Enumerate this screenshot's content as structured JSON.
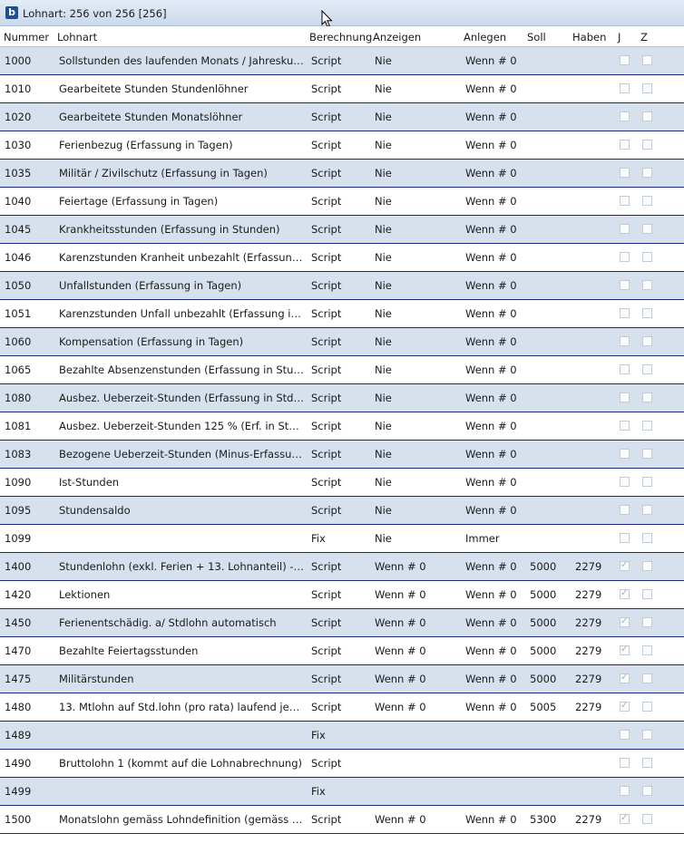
{
  "window": {
    "icon_letter": "b",
    "title": "Lohnart: 256 von 256 [256]"
  },
  "columns": [
    "Nummer",
    "Lohnart",
    "Berechnung",
    "Anzeigen",
    "Anlegen",
    "Soll",
    "Haben",
    "J",
    "Z"
  ],
  "rows": [
    {
      "nummer": "1000",
      "lohnart": "Sollstunden des laufenden Monats / Jahreskum...",
      "berechnung": "Script",
      "anzeigen": "Nie",
      "anlegen": "Wenn # 0",
      "soll": "",
      "haben": "",
      "j": false,
      "z": false
    },
    {
      "nummer": "1010",
      "lohnart": "Gearbeitete Stunden Stundenlöhner",
      "berechnung": "Script",
      "anzeigen": "Nie",
      "anlegen": "Wenn # 0",
      "soll": "",
      "haben": "",
      "j": false,
      "z": false
    },
    {
      "nummer": "1020",
      "lohnart": "Gearbeitete Stunden Monatslöhner",
      "berechnung": "Script",
      "anzeigen": "Nie",
      "anlegen": "Wenn # 0",
      "soll": "",
      "haben": "",
      "j": false,
      "z": false
    },
    {
      "nummer": "1030",
      "lohnart": "Ferienbezug (Erfassung in Tagen)",
      "berechnung": "Script",
      "anzeigen": "Nie",
      "anlegen": "Wenn # 0",
      "soll": "",
      "haben": "",
      "j": false,
      "z": false
    },
    {
      "nummer": "1035",
      "lohnart": "Militär / Zivilschutz (Erfassung in Tagen)",
      "berechnung": "Script",
      "anzeigen": "Nie",
      "anlegen": "Wenn # 0",
      "soll": "",
      "haben": "",
      "j": false,
      "z": false
    },
    {
      "nummer": "1040",
      "lohnart": "Feiertage (Erfassung in Tagen)",
      "berechnung": "Script",
      "anzeigen": "Nie",
      "anlegen": "Wenn # 0",
      "soll": "",
      "haben": "",
      "j": false,
      "z": false
    },
    {
      "nummer": "1045",
      "lohnart": "Krankheitsstunden (Erfassung in Stunden)",
      "berechnung": "Script",
      "anzeigen": "Nie",
      "anlegen": "Wenn # 0",
      "soll": "",
      "haben": "",
      "j": false,
      "z": false
    },
    {
      "nummer": "1046",
      "lohnart": "Karenzstunden Kranheit unbezahlt (Erfassung i...",
      "berechnung": "Script",
      "anzeigen": "Nie",
      "anlegen": "Wenn # 0",
      "soll": "",
      "haben": "",
      "j": false,
      "z": false
    },
    {
      "nummer": "1050",
      "lohnart": "Unfallstunden (Erfassung in Tagen)",
      "berechnung": "Script",
      "anzeigen": "Nie",
      "anlegen": "Wenn # 0",
      "soll": "",
      "haben": "",
      "j": false,
      "z": false
    },
    {
      "nummer": "1051",
      "lohnart": "Karenzstunden Unfall unbezahlt (Erfassung in T...",
      "berechnung": "Script",
      "anzeigen": "Nie",
      "anlegen": "Wenn # 0",
      "soll": "",
      "haben": "",
      "j": false,
      "z": false
    },
    {
      "nummer": "1060",
      "lohnart": "Kompensation (Erfassung in Tagen)",
      "berechnung": "Script",
      "anzeigen": "Nie",
      "anlegen": "Wenn # 0",
      "soll": "",
      "haben": "",
      "j": false,
      "z": false
    },
    {
      "nummer": "1065",
      "lohnart": "Bezahlte Absenzenstunden (Erfassung in Stund...",
      "berechnung": "Script",
      "anzeigen": "Nie",
      "anlegen": "Wenn # 0",
      "soll": "",
      "haben": "",
      "j": false,
      "z": false
    },
    {
      "nummer": "1080",
      "lohnart": "Ausbez. Ueberzeit-Stunden (Erfassung in Std, s...",
      "berechnung": "Script",
      "anzeigen": "Nie",
      "anlegen": "Wenn # 0",
      "soll": "",
      "haben": "",
      "j": false,
      "z": false
    },
    {
      "nummer": "1081",
      "lohnart": "Ausbez. Ueberzeit-Stunden 125 % (Erf. in Std,...",
      "berechnung": "Script",
      "anzeigen": "Nie",
      "anlegen": "Wenn # 0",
      "soll": "",
      "haben": "",
      "j": false,
      "z": false
    },
    {
      "nummer": "1083",
      "lohnart": "Bezogene Ueberzeit-Stunden (Minus-Erfassung...",
      "berechnung": "Script",
      "anzeigen": "Nie",
      "anlegen": "Wenn # 0",
      "soll": "",
      "haben": "",
      "j": false,
      "z": false
    },
    {
      "nummer": "1090",
      "lohnart": "Ist-Stunden",
      "berechnung": "Script",
      "anzeigen": "Nie",
      "anlegen": "Wenn # 0",
      "soll": "",
      "haben": "",
      "j": false,
      "z": false
    },
    {
      "nummer": "1095",
      "lohnart": "Stundensaldo",
      "berechnung": "Script",
      "anzeigen": "Nie",
      "anlegen": "Wenn # 0",
      "soll": "",
      "haben": "",
      "j": false,
      "z": false
    },
    {
      "nummer": "1099",
      "lohnart": "",
      "berechnung": "Fix",
      "anzeigen": "Nie",
      "anlegen": "Immer",
      "soll": "",
      "haben": "",
      "j": false,
      "z": false
    },
    {
      "nummer": "1400",
      "lohnart": "Stundenlohn (exkl. Ferien + 13. Lohnanteil) ->...",
      "berechnung": "Script",
      "anzeigen": "Wenn # 0",
      "anlegen": "Wenn # 0",
      "soll": "5000",
      "haben": "2279",
      "j": true,
      "z": false
    },
    {
      "nummer": "1420",
      "lohnart": "Lektionen",
      "berechnung": "Script",
      "anzeigen": "Wenn # 0",
      "anlegen": "Wenn # 0",
      "soll": "5000",
      "haben": "2279",
      "j": true,
      "z": false
    },
    {
      "nummer": "1450",
      "lohnart": "Ferienentschädig. a/ Stdlohn automatisch",
      "berechnung": "Script",
      "anzeigen": "Wenn # 0",
      "anlegen": "Wenn # 0",
      "soll": "5000",
      "haben": "2279",
      "j": true,
      "z": false
    },
    {
      "nummer": "1470",
      "lohnart": "Bezahlte Feiertagsstunden",
      "berechnung": "Script",
      "anzeigen": "Wenn # 0",
      "anlegen": "Wenn # 0",
      "soll": "5000",
      "haben": "2279",
      "j": true,
      "z": false
    },
    {
      "nummer": "1475",
      "lohnart": "Militärstunden",
      "berechnung": "Script",
      "anzeigen": "Wenn # 0",
      "anlegen": "Wenn # 0",
      "soll": "5000",
      "haben": "2279",
      "j": true,
      "z": false
    },
    {
      "nummer": "1480",
      "lohnart": "13. Mtlohn auf Std.lohn (pro rata) laufend jede...",
      "berechnung": "Script",
      "anzeigen": "Wenn # 0",
      "anlegen": "Wenn # 0",
      "soll": "5005",
      "haben": "2279",
      "j": true,
      "z": false
    },
    {
      "nummer": "1489",
      "lohnart": "",
      "berechnung": "Fix",
      "anzeigen": "",
      "anlegen": "",
      "soll": "",
      "haben": "",
      "j": false,
      "z": false
    },
    {
      "nummer": "1490",
      "lohnart": "Bruttolohn 1 (kommt auf die Lohnabrechnung)",
      "berechnung": "Script",
      "anzeigen": "",
      "anlegen": "",
      "soll": "",
      "haben": "",
      "j": false,
      "z": false
    },
    {
      "nummer": "1499",
      "lohnart": "",
      "berechnung": "Fix",
      "anzeigen": "",
      "anlegen": "",
      "soll": "",
      "haben": "",
      "j": false,
      "z": false
    },
    {
      "nummer": "1500",
      "lohnart": "Monatslohn gemäss Lohndefinition (gemäss Be...",
      "berechnung": "Script",
      "anzeigen": "Wenn # 0",
      "anlegen": "Wenn # 0",
      "soll": "5300",
      "haben": "2279",
      "j": true,
      "z": false
    }
  ]
}
